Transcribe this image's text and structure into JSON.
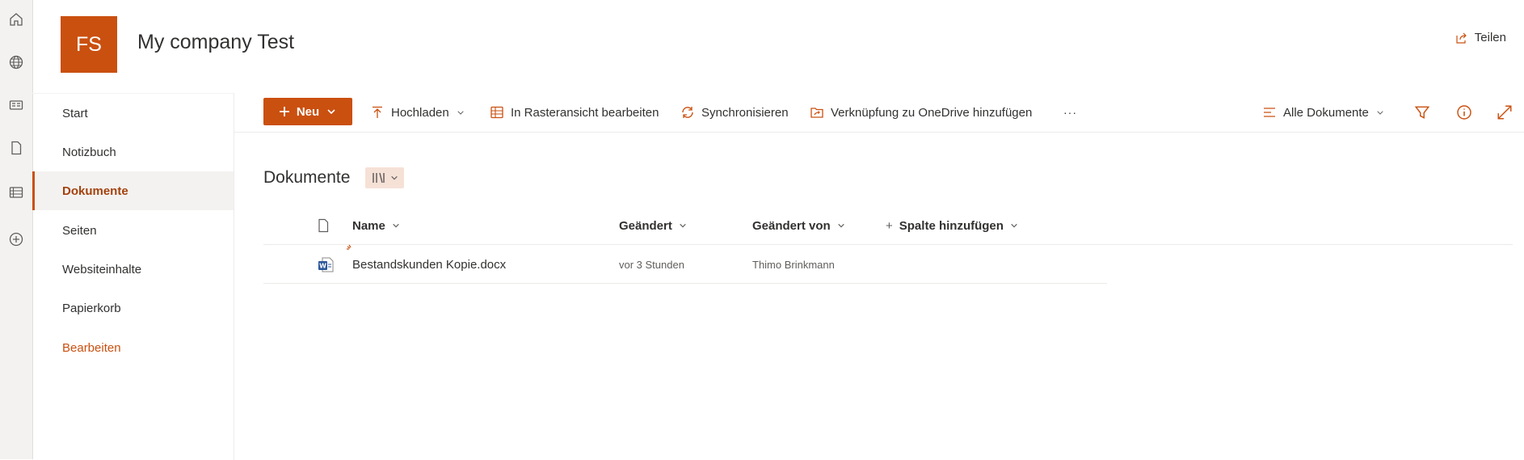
{
  "site": {
    "logo_initials": "FS",
    "title": "My company Test",
    "share_label": "Teilen"
  },
  "colors": {
    "accent": "#ca5010",
    "accent_light": "#f6e1d7",
    "nav_selected_text": "#a4420e"
  },
  "rail": {
    "icons": [
      "home-icon",
      "globe-icon",
      "news-icon",
      "file-icon",
      "list-icon",
      "add-circle-icon"
    ]
  },
  "nav": {
    "items": [
      {
        "label": "Start"
      },
      {
        "label": "Notizbuch"
      },
      {
        "label": "Dokumente"
      },
      {
        "label": "Seiten"
      },
      {
        "label": "Websiteinhalte"
      },
      {
        "label": "Papierkorb"
      },
      {
        "label": "Bearbeiten"
      }
    ],
    "selected": "Dokumente"
  },
  "commands": {
    "new": "Neu",
    "upload": "Hochladen",
    "grid": "In Rasteransicht bearbeiten",
    "sync": "Synchronisieren",
    "shortcut": "Verknüpfung zu OneDrive hinzufügen",
    "more": "···",
    "view": "Alle Dokumente"
  },
  "library": {
    "title": "Dokumente",
    "columns": [
      "Name",
      "Geändert",
      "Geändert von",
      "Spalte hinzufügen"
    ],
    "rows": [
      {
        "name": "Bestandskunden Kopie.docx",
        "modified": "vor 3 Stunden",
        "modified_by": "Thimo Brinkmann",
        "icon": "word-doc-icon"
      }
    ]
  }
}
